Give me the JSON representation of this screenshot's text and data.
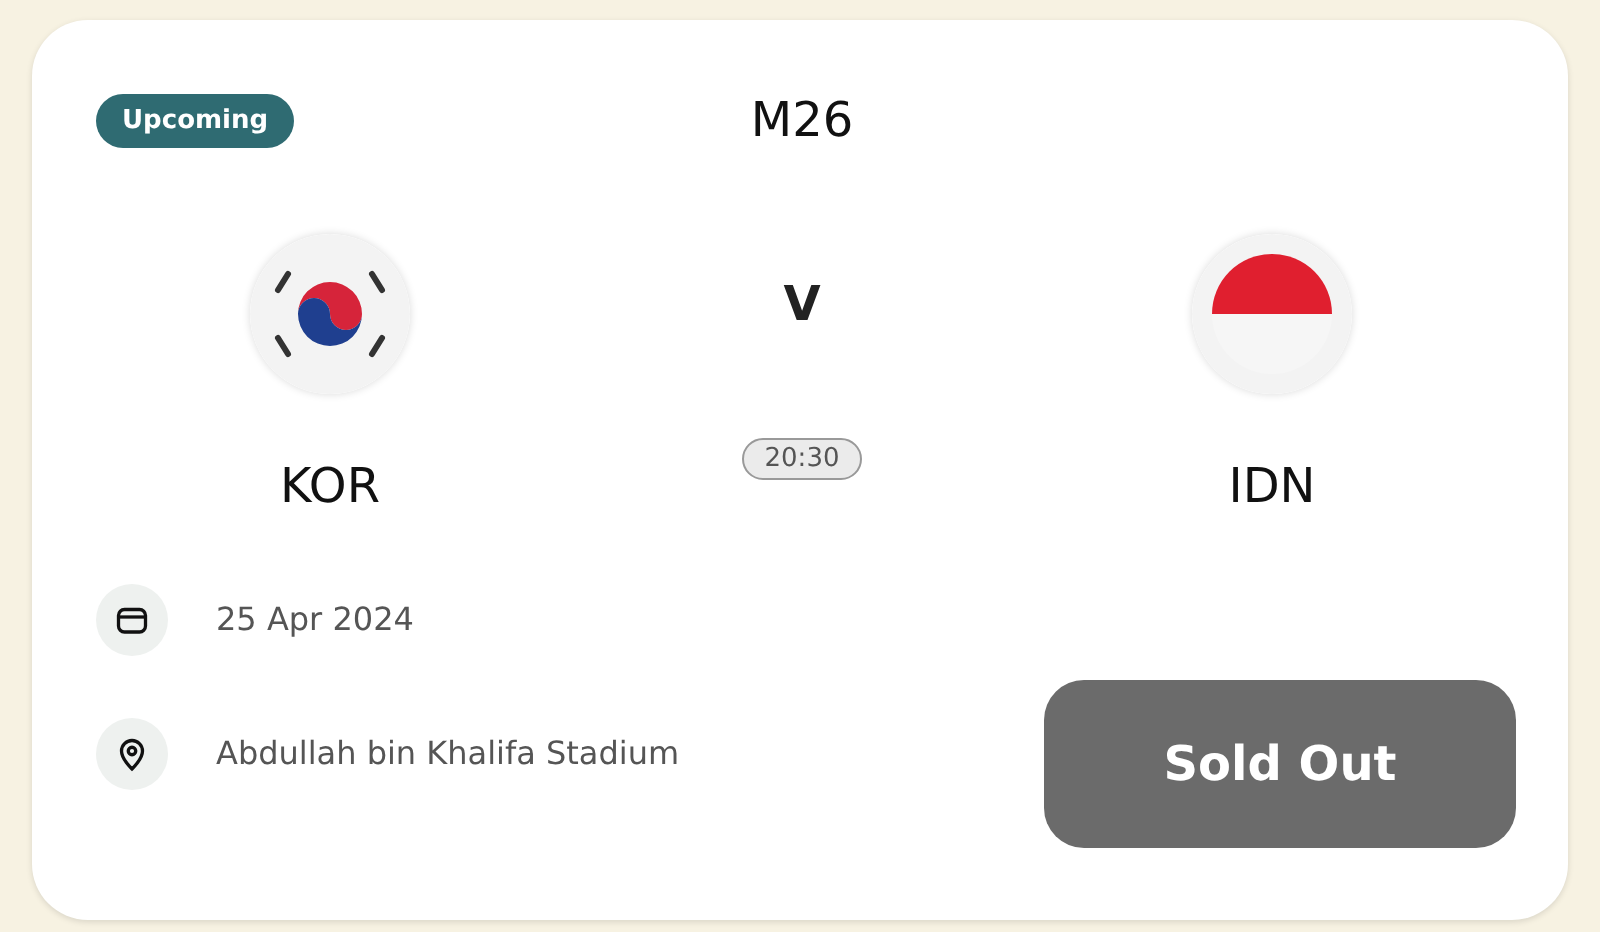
{
  "status": {
    "label": "Upcoming"
  },
  "match": {
    "code": "M26",
    "versus": "V",
    "time": "20:30"
  },
  "teams": [
    {
      "name": "KOR",
      "kind": "taegeuk"
    },
    {
      "name": "IDN",
      "kind": "bicolor"
    }
  ],
  "info": [
    {
      "kind": "date",
      "text": "25 Apr 2024"
    },
    {
      "kind": "location",
      "text": "Abdullah bin Khalifa Stadium"
    }
  ],
  "action": {
    "label": "Sold Out",
    "disabled": true
  }
}
